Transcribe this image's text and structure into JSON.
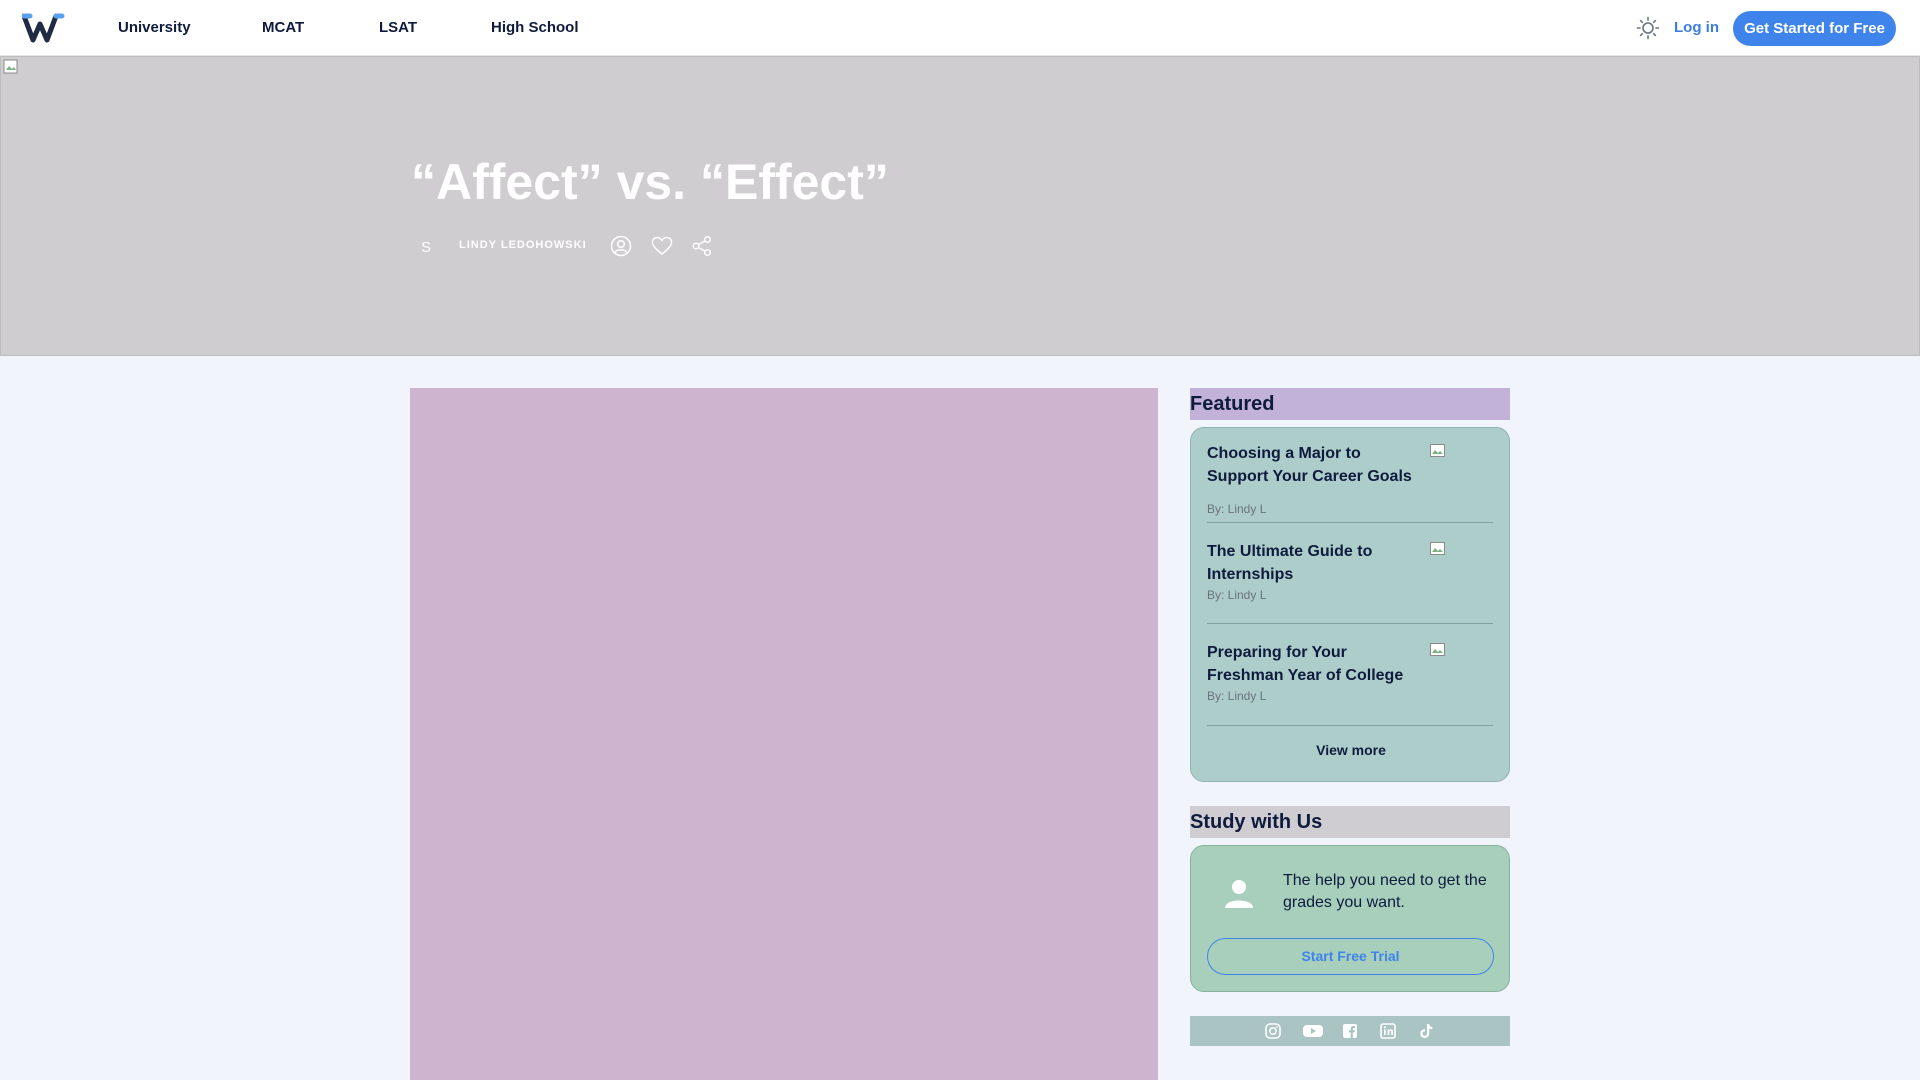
{
  "nav": {
    "logo": "wizeprep-logo",
    "links": [
      "University",
      "MCAT",
      "LSAT",
      "High School"
    ],
    "theme_icon": "sun-icon",
    "login": "Log in",
    "cta": "Get Started for Free"
  },
  "hero": {
    "title": "“Affect” vs. “Effect”",
    "author_initial": "S",
    "author": "LINDY LEDOHOWSKI",
    "icons": [
      "user-icon",
      "heart-icon",
      "share-icon"
    ]
  },
  "sidebar": {
    "featured_title": "Featured",
    "featured_items": [
      {
        "title": "Choosing a Major to Support Your Career Goals",
        "by": "By: Lindy L"
      },
      {
        "title": "The Ultimate Guide to Internships",
        "by": "By: Lindy L"
      },
      {
        "title": "Preparing for Your Freshman Year of College",
        "by": "By: Lindy L"
      }
    ],
    "view_more": "View more",
    "study_title": "Study with Us",
    "study_text": "The help you need to get the grades you want.",
    "study_button": "Start Free Trial",
    "social_icons": [
      "instagram-icon",
      "youtube-icon",
      "facebook-icon",
      "linkedin-icon",
      "tiktok-icon"
    ]
  },
  "colors": {
    "accent": "#3f84ea",
    "hero_bg": "#cfcdcf",
    "article_bg": "#ceb4cf",
    "featured_bg": "#adcdca",
    "study_bg": "#a7cfbb"
  }
}
